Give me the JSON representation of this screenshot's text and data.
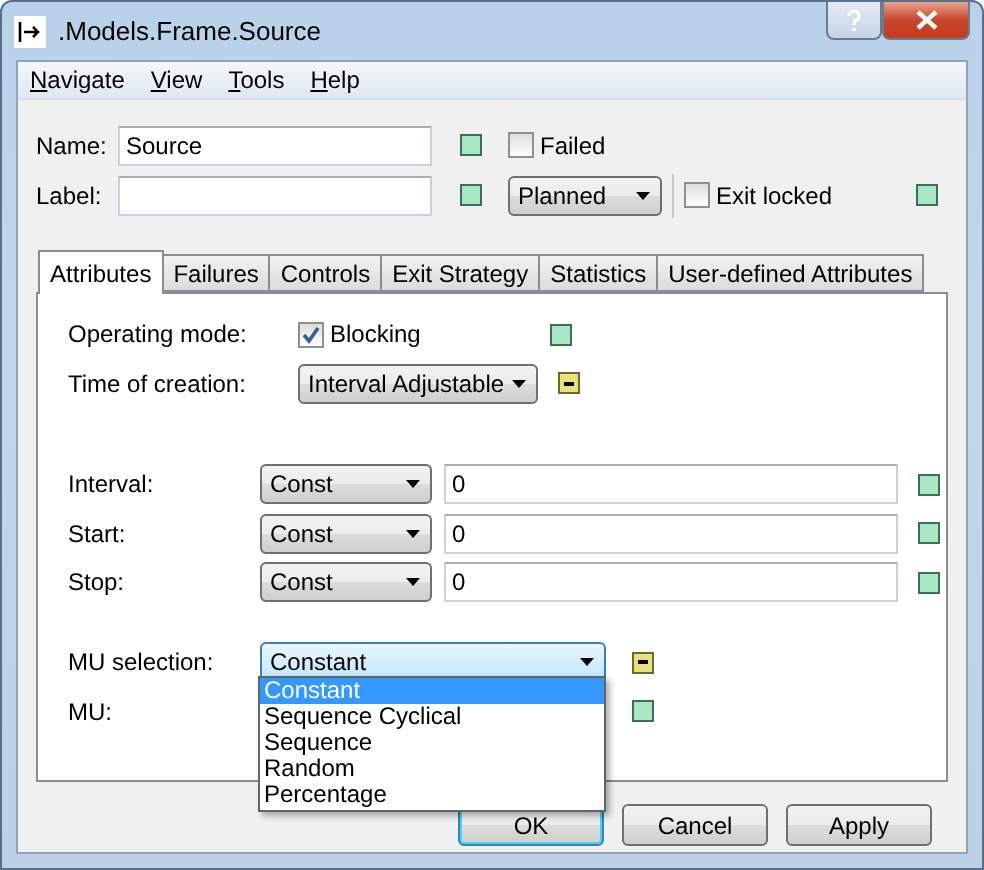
{
  "window": {
    "title": ".Models.Frame.Source"
  },
  "menu": [
    "Navigate",
    "View",
    "Tools",
    "Help"
  ],
  "fields": [
    {
      "label": "Name:",
      "value": "Source",
      "inherited": false
    },
    {
      "label": "Label:",
      "inherited": false
    }
  ],
  "failed": {
    "label": "Failed",
    "checked": false
  },
  "state_combo": {
    "value": "Planned"
  },
  "exit_locked": {
    "label": "Exit locked",
    "checked": false,
    "inherited": false
  },
  "tabs": [
    {
      "label": "Attributes",
      "selected": true
    },
    {
      "label": "Failures",
      "selected": false
    },
    {
      "label": "Controls",
      "selected": false
    },
    {
      "label": "Exit Strategy",
      "selected": false
    },
    {
      "label": "Statistics",
      "selected": false
    },
    {
      "label": "User-defined Attributes",
      "selected": false
    }
  ],
  "attributes": {
    "operating_mode": {
      "label": "Operating mode:",
      "checkbox_label": "Blocking",
      "checked": true,
      "inherited": false
    },
    "time_of_creation": {
      "label": "Time of creation:",
      "value": "Interval Adjustable",
      "inherited": true
    },
    "times": [
      {
        "label": "Interval:",
        "distribution": "Const",
        "value": "0",
        "inherited": false
      },
      {
        "label": "Start:",
        "distribution": "Const",
        "value": "0",
        "inherited": false
      },
      {
        "label": "Stop:",
        "distribution": "Const",
        "value": "0",
        "inherited": false
      }
    ],
    "mu_selection": {
      "label": "MU selection:",
      "value": "Constant",
      "inherited": true,
      "expanded": true,
      "options": [
        {
          "label": "Constant",
          "selected": true
        },
        {
          "label": "Sequence Cyclical",
          "selected": false
        },
        {
          "label": "Sequence",
          "selected": false
        },
        {
          "label": "Random",
          "selected": false
        },
        {
          "label": "Percentage",
          "selected": false
        }
      ]
    },
    "mu": {
      "label": "MU:",
      "inherited": false
    }
  },
  "buttons": [
    {
      "label": "OK",
      "default": true
    },
    {
      "label": "Cancel",
      "default": false
    },
    {
      "label": "Apply",
      "default": false
    }
  ]
}
